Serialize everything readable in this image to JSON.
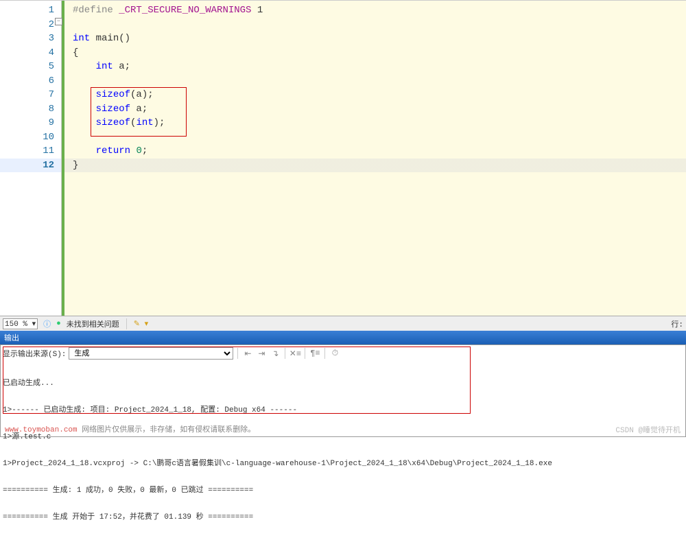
{
  "editor": {
    "lines": [
      1,
      2,
      3,
      4,
      5,
      6,
      7,
      8,
      9,
      10,
      11,
      12
    ],
    "code": {
      "l1": {
        "pre": "#define",
        "macro": " _CRT_SECURE_NO_WARNINGS",
        "end": " 1"
      },
      "l3": {
        "kw": "int",
        "rest": " main()"
      },
      "l4": "{",
      "l5": {
        "indent": "    ",
        "kw": "int",
        "rest": " a;"
      },
      "l7": {
        "indent": "    ",
        "kw": "sizeof",
        "rest": "(a);"
      },
      "l8": {
        "indent": "    ",
        "kw": "sizeof",
        "rest": " a;"
      },
      "l9": {
        "indent": "    ",
        "kw": "sizeof",
        "open": "(",
        "type": "int",
        "close": ");"
      },
      "l11": {
        "indent": "    ",
        "kw": "return",
        "rest": " ",
        "num": "0",
        "semi": ";"
      },
      "l12": "}"
    },
    "fold_glyph": "−"
  },
  "status": {
    "zoom": "150 %",
    "ok_icon": "●",
    "msg": "未找到相关问题",
    "brush_icon": "✎",
    "brush_arrow": "▾",
    "right": "行:"
  },
  "output": {
    "title": "输出",
    "src_label": "显示输出来源(S):",
    "src_value": "生成",
    "icons": {
      "goto_prev": "⇤",
      "goto_next": "⇥",
      "step": "↴",
      "clear": "✕≡",
      "toggle": "¶≡",
      "find": "⏱"
    },
    "lines": [
      "已启动生成...",
      "1>------ 已启动生成: 项目: Project_2024_1_18, 配置: Debug x64 ------",
      "1>源.test.c",
      "1>Project_2024_1_18.vcxproj -> C:\\鹏哥c语言暑假集训\\c-language-warehouse-1\\Project_2024_1_18\\x64\\Debug\\Project_2024_1_18.exe",
      "========== 生成: 1 成功，0 失败，0 最新，0 已跳过 ==========",
      "========== 生成 开始于 17:52，并花费了 01.139 秒 =========="
    ]
  },
  "watermark": {
    "url": "www.toymoban.com",
    "text": " 网络图片仅供展示，非存储，如有侵权请联系删除。",
    "csdn": "CSDN @睡觉待开机"
  }
}
